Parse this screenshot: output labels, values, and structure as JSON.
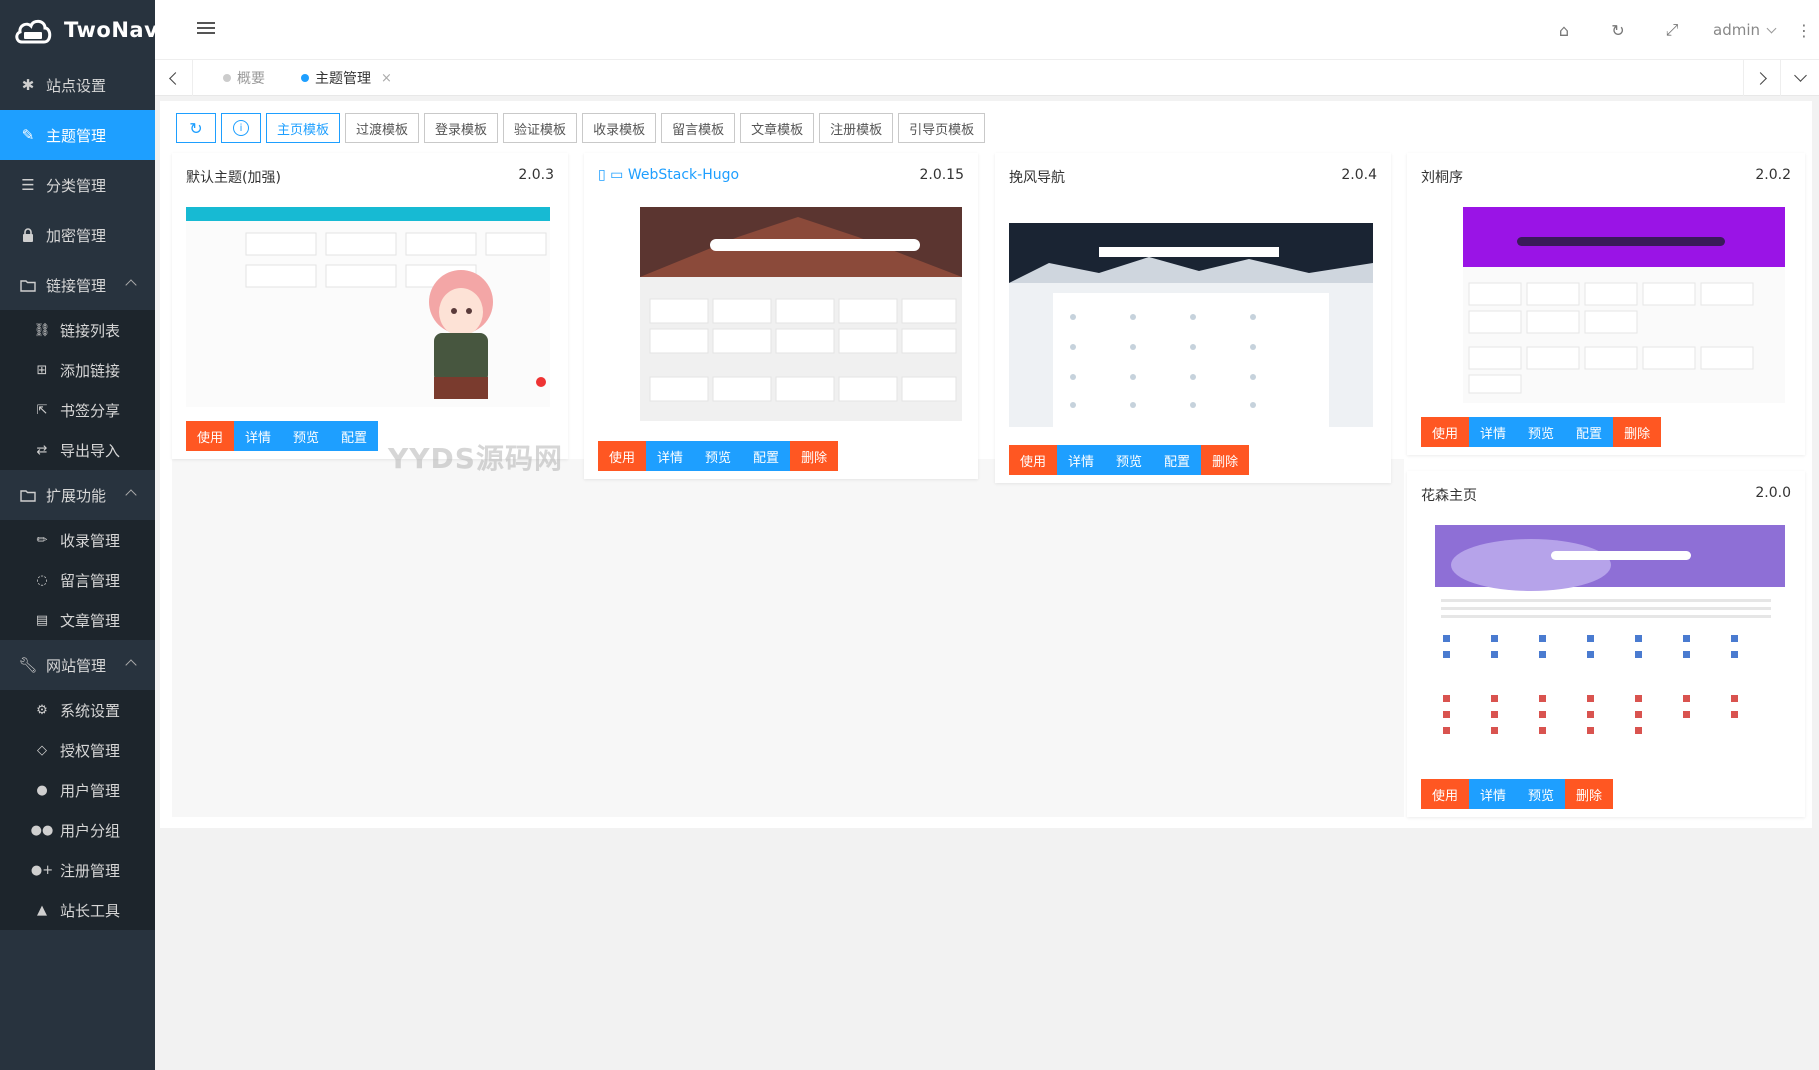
{
  "app": {
    "name": "TwoNav"
  },
  "sidebar": {
    "items": [
      {
        "label": "站点设置",
        "icon": "gear-icon"
      },
      {
        "label": "主题管理",
        "icon": "brush-icon",
        "active": true
      },
      {
        "label": "分类管理",
        "icon": "list-icon"
      },
      {
        "label": "加密管理",
        "icon": "lock-icon"
      },
      {
        "label": "链接管理",
        "icon": "folder-icon",
        "expanded": true,
        "children": [
          {
            "label": "链接列表",
            "icon": "link-icon"
          },
          {
            "label": "添加链接",
            "icon": "plus-square-icon"
          },
          {
            "label": "书签分享",
            "icon": "share-icon"
          },
          {
            "label": "导出导入",
            "icon": "swap-icon"
          }
        ]
      },
      {
        "label": "扩展功能",
        "icon": "folder-icon",
        "expanded": true,
        "children": [
          {
            "label": "收录管理",
            "icon": "pencil-icon"
          },
          {
            "label": "留言管理",
            "icon": "comment-icon"
          },
          {
            "label": "文章管理",
            "icon": "file-icon"
          }
        ]
      },
      {
        "label": "网站管理",
        "icon": "wrench-icon",
        "expanded": true,
        "children": [
          {
            "label": "系统设置",
            "icon": "gears-icon"
          },
          {
            "label": "授权管理",
            "icon": "diamond-icon"
          },
          {
            "label": "用户管理",
            "icon": "user-icon"
          },
          {
            "label": "用户分组",
            "icon": "users-icon"
          },
          {
            "label": "注册管理",
            "icon": "user-plus-icon"
          },
          {
            "label": "站长工具",
            "icon": "warning-icon"
          }
        ]
      }
    ]
  },
  "header": {
    "user": "admin"
  },
  "tabs": [
    {
      "label": "概要",
      "active": false
    },
    {
      "label": "主题管理",
      "active": true,
      "close": "×"
    }
  ],
  "toolbar": {
    "buttons": [
      "主页模板",
      "过渡模板",
      "登录模板",
      "验证模板",
      "收录模板",
      "留言模板",
      "文章模板",
      "注册模板",
      "引导页模板"
    ],
    "selected": "主页模板"
  },
  "themes": [
    {
      "name": "默认主题(加强)",
      "version": "2.0.3",
      "buttons": [
        "使用",
        "详情",
        "预览",
        "配置"
      ]
    },
    {
      "name": "WebStack-Hugo",
      "version": "2.0.15",
      "buttons": [
        "使用",
        "详情",
        "预览",
        "配置",
        "删除"
      ]
    },
    {
      "name": "挽风导航",
      "version": "2.0.4",
      "buttons": [
        "使用",
        "详情",
        "预览",
        "配置",
        "删除"
      ]
    },
    {
      "name": "刘桐序",
      "version": "2.0.2",
      "buttons": [
        "使用",
        "详情",
        "预览",
        "配置",
        "删除"
      ]
    },
    {
      "name": "花森主页",
      "version": "2.0.0",
      "buttons": [
        "使用",
        "详情",
        "预览",
        "删除"
      ]
    }
  ],
  "watermark": "YYDS源码网",
  "colors": {
    "sidebar": "#28333e",
    "accent": "#1e9fff",
    "danger": "#ff5722"
  }
}
